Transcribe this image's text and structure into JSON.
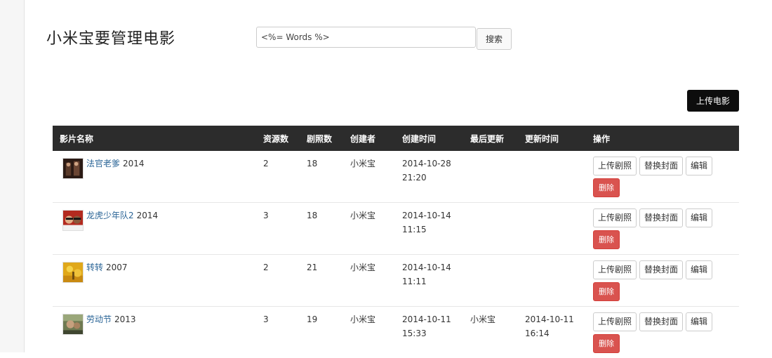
{
  "header": {
    "title": "小米宝要管理电影",
    "search_value": "<%= Words %>",
    "search_button": "搜索"
  },
  "toolbar": {
    "upload_movie": "上传电影"
  },
  "table": {
    "columns": [
      "影片名称",
      "资源数",
      "剧照数",
      "创建者",
      "创建时间",
      "最后更新",
      "更新时间",
      "操作"
    ],
    "rows": [
      {
        "title": "法官老爹",
        "year": "2014",
        "resources": "2",
        "stills": "18",
        "creator": "小米宝",
        "created_date": "2014-10-28",
        "created_time": "21:20",
        "last_updater": "",
        "updated_date": "",
        "updated_time": ""
      },
      {
        "title": "龙虎少年队2",
        "year": "2014",
        "resources": "3",
        "stills": "18",
        "creator": "小米宝",
        "created_date": "2014-10-14",
        "created_time": "11:15",
        "last_updater": "",
        "updated_date": "",
        "updated_time": ""
      },
      {
        "title": "转转",
        "year": "2007",
        "resources": "2",
        "stills": "21",
        "creator": "小米宝",
        "created_date": "2014-10-14",
        "created_time": "11:11",
        "last_updater": "",
        "updated_date": "",
        "updated_time": ""
      },
      {
        "title": "劳动节",
        "year": "2013",
        "resources": "3",
        "stills": "19",
        "creator": "小米宝",
        "created_date": "2014-10-11",
        "created_time": "15:33",
        "last_updater": "小米宝",
        "updated_date": "2014-10-11",
        "updated_time": "16:14"
      }
    ],
    "actions": {
      "upload_stills": "上传剧照",
      "replace_cover": "替换封面",
      "edit": "编辑",
      "delete": "删除"
    }
  },
  "colors": {
    "header_bg": "#2c2c2c",
    "link": "#2a6496",
    "danger": "#d9534f",
    "primary_button": "#0d0d0d"
  }
}
